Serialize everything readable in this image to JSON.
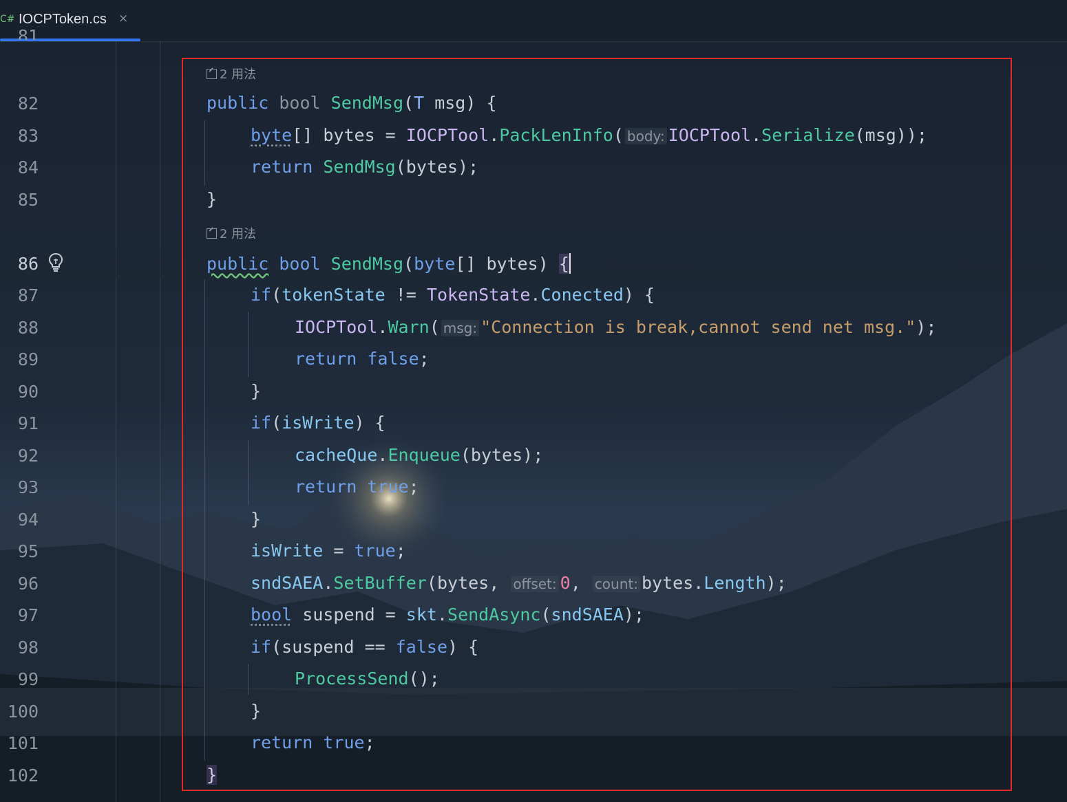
{
  "tab": {
    "lang_badge": "C#",
    "title": "IOCPToken.cs",
    "close": "×"
  },
  "usages": {
    "first": "2 用法",
    "second": "2 用法"
  },
  "line_numbers": {
    "top_partial": "81",
    "n82": "82",
    "n83": "83",
    "n84": "84",
    "n85": "85",
    "n86": "86",
    "n87": "87",
    "n88": "88",
    "n89": "89",
    "n90": "90",
    "n91": "91",
    "n92": "92",
    "n93": "93",
    "n94": "94",
    "n95": "95",
    "n96": "96",
    "n97": "97",
    "n98": "98",
    "n99": "99",
    "n100": "100",
    "n101": "101",
    "n102": "102"
  },
  "code": {
    "l82": {
      "kw1": "public",
      "kw2": "bool",
      "fn": "SendMsg",
      "p1": "(",
      "ty": "T",
      "rest": " msg) {"
    },
    "l83": {
      "kw": "byte",
      "a": "[] bytes = ",
      "cls1": "IOCPTool",
      "dot1": ".",
      "fn1": "PackLenInfo",
      "p": "(",
      "hint": "body:",
      "cls2": "IOCPTool",
      "dot2": ".",
      "fn2": "Serialize",
      "end": "(msg));"
    },
    "l84": {
      "kw": "return",
      "fn": "SendMsg",
      "end": "(bytes);"
    },
    "l85": {
      "brace": "}"
    },
    "l86": {
      "kw1": "public",
      "kw2": "bool",
      "fn": "SendMsg",
      "p": "(",
      "kw3": "byte",
      "rest": "[] bytes) ",
      "brace": "{"
    },
    "l87": {
      "kw": "if",
      "p": "(",
      "fld": "tokenState",
      "op": " != ",
      "cls": "TokenState",
      "dot": ".",
      "en": "Conected",
      "end": ") {"
    },
    "l88": {
      "cls": "IOCPTool",
      "dot": ".",
      "fn": "Warn",
      "p": "(",
      "hint": "msg:",
      "str": "\"Connection is break,cannot send net msg.\"",
      "end": ");"
    },
    "l89": {
      "kw": "return",
      "val": "false",
      "end": ";"
    },
    "l90": {
      "brace": "}"
    },
    "l91": {
      "kw": "if",
      "p": "(",
      "fld": "isWrite",
      "end": ") {"
    },
    "l92": {
      "fld": "cacheQue",
      "dot": ".",
      "fn": "Enqueue",
      "end": "(bytes);"
    },
    "l93": {
      "kw": "return",
      "val": "true",
      "end": ";"
    },
    "l94": {
      "brace": "}"
    },
    "l95": {
      "fld": "isWrite",
      "op": " = ",
      "val": "true",
      "end": ";"
    },
    "l96": {
      "fld": "sndSAEA",
      "dot": ".",
      "fn": "SetBuffer",
      "a": "(bytes, ",
      "hint1": "offset:",
      "num": "0",
      "b": ", ",
      "hint2": "count:",
      "c": "bytes.",
      "prop": "Length",
      "end": ");"
    },
    "l97": {
      "kw": "bool",
      "a": " suspend = ",
      "fld1": "skt",
      "dot": ".",
      "fn": "SendAsync",
      "p": "(",
      "fld2": "sndSAEA",
      "end": ");"
    },
    "l98": {
      "kw": "if",
      "a": "(suspend == ",
      "val": "false",
      "end": ") {"
    },
    "l99": {
      "fn": "ProcessSend",
      "end": "();"
    },
    "l100": {
      "brace": "}"
    },
    "l101": {
      "kw": "return",
      "val": "true",
      "end": ";"
    },
    "l102": {
      "brace": "}"
    }
  },
  "colors": {
    "keyword": "#6f9fe8",
    "function": "#4ec9a0",
    "type": "#c9b5f0",
    "string": "#c79e6a",
    "number": "#ec7fa6",
    "field": "#88c8f0",
    "highlight_box": "#e02a2a",
    "tab_underline": "#3574f0"
  },
  "icons": {
    "usage": "usage-link-icon",
    "gutter": "lightbulb-icon",
    "tab_close": "close-icon"
  }
}
